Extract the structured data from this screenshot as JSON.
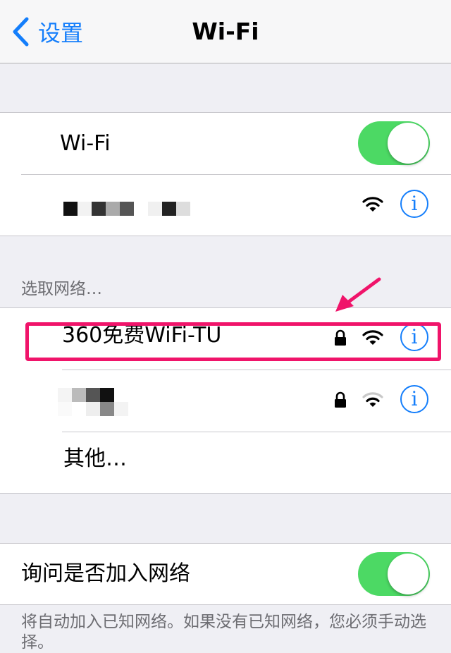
{
  "nav": {
    "back_label": "设置",
    "title": "Wi-Fi"
  },
  "wifi_group": {
    "wifi_label": "Wi-Fi",
    "wifi_on": true,
    "current_network_name_obscured": true
  },
  "networks": {
    "section_header": "选取网络…",
    "items": [
      {
        "name": "360免费WiFi-TU",
        "locked": true,
        "signal": "full",
        "highlighted": true
      },
      {
        "name": "",
        "obscured": true,
        "locked": true,
        "signal": "medium"
      }
    ],
    "other_label": "其他…"
  },
  "ask_join": {
    "label": "询问是否加入网络",
    "enabled": true,
    "footer": "将自动加入已知网络。如果没有已知网络，您必须手动选择。"
  },
  "colors": {
    "accent": "#147efb",
    "toggle_on": "#4cd964",
    "highlight": "#f0146a"
  },
  "icons": {
    "back": "chevron-left-icon",
    "info": "info-icon",
    "wifi": "wifi-icon",
    "lock": "lock-icon",
    "arrow": "arrow-annotation-icon"
  }
}
